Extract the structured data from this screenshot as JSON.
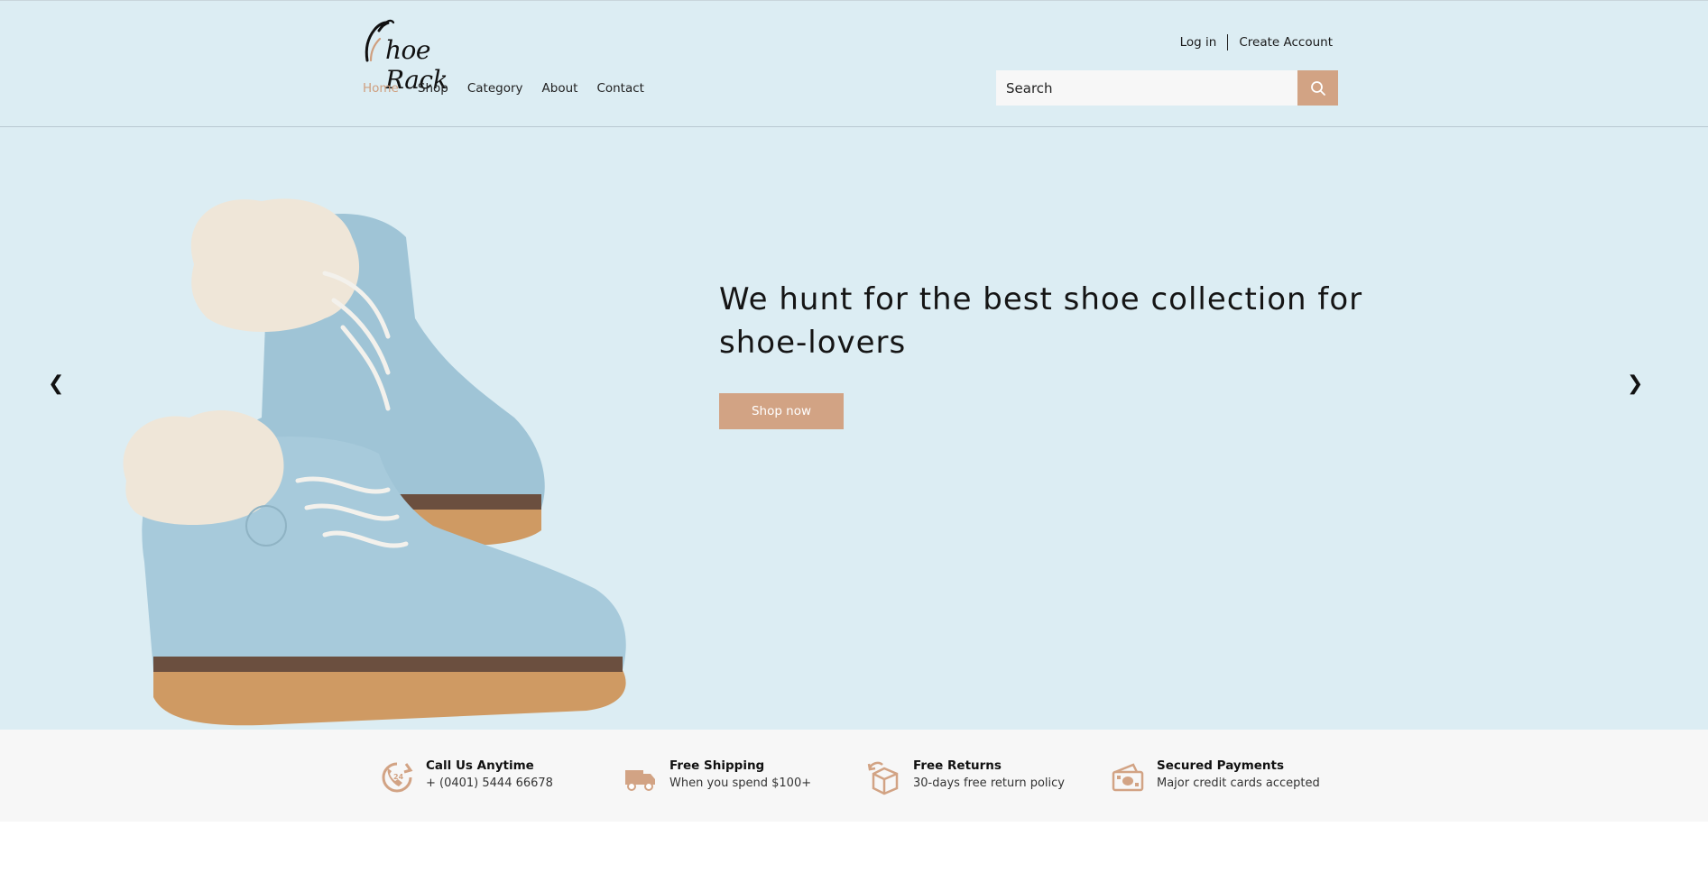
{
  "header": {
    "logo_text": "hoe Rack",
    "logo_letter": "S",
    "nav": [
      {
        "label": "Home",
        "active": true
      },
      {
        "label": "Shop",
        "active": false
      },
      {
        "label": "Category",
        "active": false
      },
      {
        "label": "About",
        "active": false
      },
      {
        "label": "Contact",
        "active": false
      }
    ],
    "login_label": "Log in",
    "create_account_label": "Create Account",
    "search": {
      "placeholder": "Search",
      "icon": "search-icon"
    }
  },
  "hero": {
    "headline": "We hunt for the best shoe collection for shoe-lovers",
    "cta_label": "Shop now",
    "prev_arrow": "❮",
    "next_arrow": "❯"
  },
  "features": [
    {
      "icon": "phone-24h-icon",
      "title": "Call Us Anytime",
      "subtitle": "+ (0401) 5444 66678"
    },
    {
      "icon": "truck-icon",
      "title": "Free Shipping",
      "subtitle": "When you spend $100+"
    },
    {
      "icon": "return-box-icon",
      "title": "Free Returns",
      "subtitle": "30-days free return policy"
    },
    {
      "icon": "cash-payment-icon",
      "title": "Secured Payments",
      "subtitle": "Major credit cards accepted"
    }
  ],
  "colors": {
    "accent": "#d2a384",
    "header_bg": "#dcedf3",
    "features_bg": "#f7f7f7",
    "active_nav": "#cf9f7f"
  }
}
